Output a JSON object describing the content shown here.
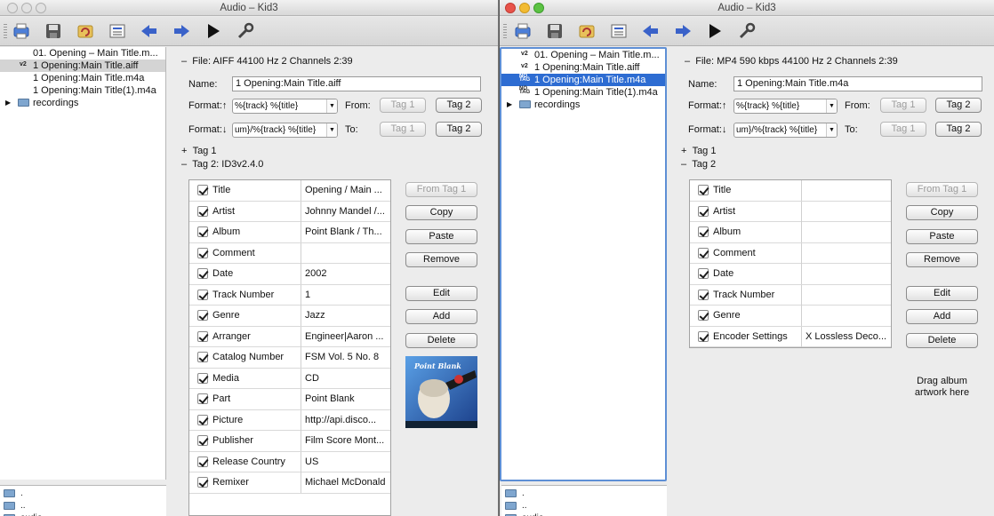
{
  "windows": [
    {
      "title": "Audio – Kid3",
      "tree": [
        {
          "tag": "",
          "label": "01. Opening – Main Title.m...",
          "selected": false
        },
        {
          "tag": "v2",
          "label": "1 Opening:Main Title.aiff",
          "selected": true
        },
        {
          "tag": "",
          "label": "1 Opening:Main Title.m4a",
          "selected": false
        },
        {
          "tag": "",
          "label": "1 Opening:Main Title(1).m4a",
          "selected": false
        }
      ],
      "folder": "recordings",
      "dirs": [
        ".",
        "..",
        "audio"
      ],
      "file_info": "File: AIFF 44100 Hz 2 Channels 2:39",
      "name_label": "Name:",
      "name_value": "1 Opening:Main Title.aiff",
      "format_up_label": "Format:↑",
      "format_up_value": "%{track} %{title}",
      "format_down_label": "Format:↓",
      "format_down_value": "um}/%{track} %{title}",
      "from_label": "From:",
      "to_label": "To:",
      "tag1_btn": "Tag 1",
      "tag2_btn": "Tag 2",
      "tag1_section": "Tag 1",
      "tag2_section": "Tag 2: ID3v2.4.0",
      "frames": [
        {
          "name": "Title",
          "value": "Opening / Main ..."
        },
        {
          "name": "Artist",
          "value": "Johnny Mandel /..."
        },
        {
          "name": "Album",
          "value": "Point Blank / Th..."
        },
        {
          "name": "Comment",
          "value": ""
        },
        {
          "name": "Date",
          "value": "2002"
        },
        {
          "name": "Track Number",
          "value": "1"
        },
        {
          "name": "Genre",
          "value": "Jazz"
        },
        {
          "name": "Arranger",
          "value": "Engineer|Aaron ..."
        },
        {
          "name": "Catalog Number",
          "value": "FSM Vol. 5 No. 8"
        },
        {
          "name": "Media",
          "value": "CD"
        },
        {
          "name": "Part",
          "value": "Point Blank"
        },
        {
          "name": "Picture",
          "value": "http://api.disco..."
        },
        {
          "name": "Publisher",
          "value": "Film Score Mont..."
        },
        {
          "name": "Release Country",
          "value": "US"
        },
        {
          "name": "Remixer",
          "value": "Michael McDonald"
        }
      ],
      "actions": {
        "from_tag": "From Tag 1",
        "copy": "Copy",
        "paste": "Paste",
        "remove": "Remove",
        "edit": "Edit",
        "add": "Add",
        "delete": "Delete"
      },
      "artwork_text": "Point Blank"
    },
    {
      "title": "Audio – Kid3",
      "tree": [
        {
          "tag": "v2",
          "label": "01. Opening – Main Title.m...",
          "selected": false
        },
        {
          "tag": "v2",
          "label": "1 Opening:Main Title.aiff",
          "selected": false
        },
        {
          "tag": "NO TAG",
          "label": "1 Opening:Main Title.m4a",
          "selected": true
        },
        {
          "tag": "NO TAG",
          "label": "1 Opening:Main Title(1).m4a",
          "selected": false
        }
      ],
      "folder": "recordings",
      "dirs": [
        ".",
        "..",
        "audio"
      ],
      "file_info": "File: MP4 590 kbps 44100 Hz 2 Channels 2:39",
      "name_label": "Name:",
      "name_value": "1 Opening:Main Title.m4a",
      "format_up_label": "Format:↑",
      "format_up_value": "%{track} %{title}",
      "format_down_label": "Format:↓",
      "format_down_value": "um}/%{track} %{title}",
      "from_label": "From:",
      "to_label": "To:",
      "tag1_btn": "Tag 1",
      "tag2_btn": "Tag 2",
      "tag1_section": "Tag 1",
      "tag2_section": "Tag 2",
      "frames": [
        {
          "name": "Title",
          "value": ""
        },
        {
          "name": "Artist",
          "value": ""
        },
        {
          "name": "Album",
          "value": ""
        },
        {
          "name": "Comment",
          "value": ""
        },
        {
          "name": "Date",
          "value": ""
        },
        {
          "name": "Track Number",
          "value": ""
        },
        {
          "name": "Genre",
          "value": ""
        },
        {
          "name": "Encoder Settings",
          "value": "X Lossless Deco..."
        }
      ],
      "actions": {
        "from_tag": "From Tag 1",
        "copy": "Copy",
        "paste": "Paste",
        "remove": "Remove",
        "edit": "Edit",
        "add": "Add",
        "delete": "Delete"
      },
      "drag_text": "Drag album artwork here"
    }
  ],
  "icons": [
    "print-icon",
    "save-icon",
    "revert-icon",
    "settings-list-icon",
    "back-arrow-icon",
    "forward-arrow-icon",
    "play-icon",
    "wrench-icon"
  ],
  "colors": {
    "selection": "#2d6cd2",
    "focus_ring": "#5e8fd5",
    "arrow_blue": "#3a62c9"
  }
}
